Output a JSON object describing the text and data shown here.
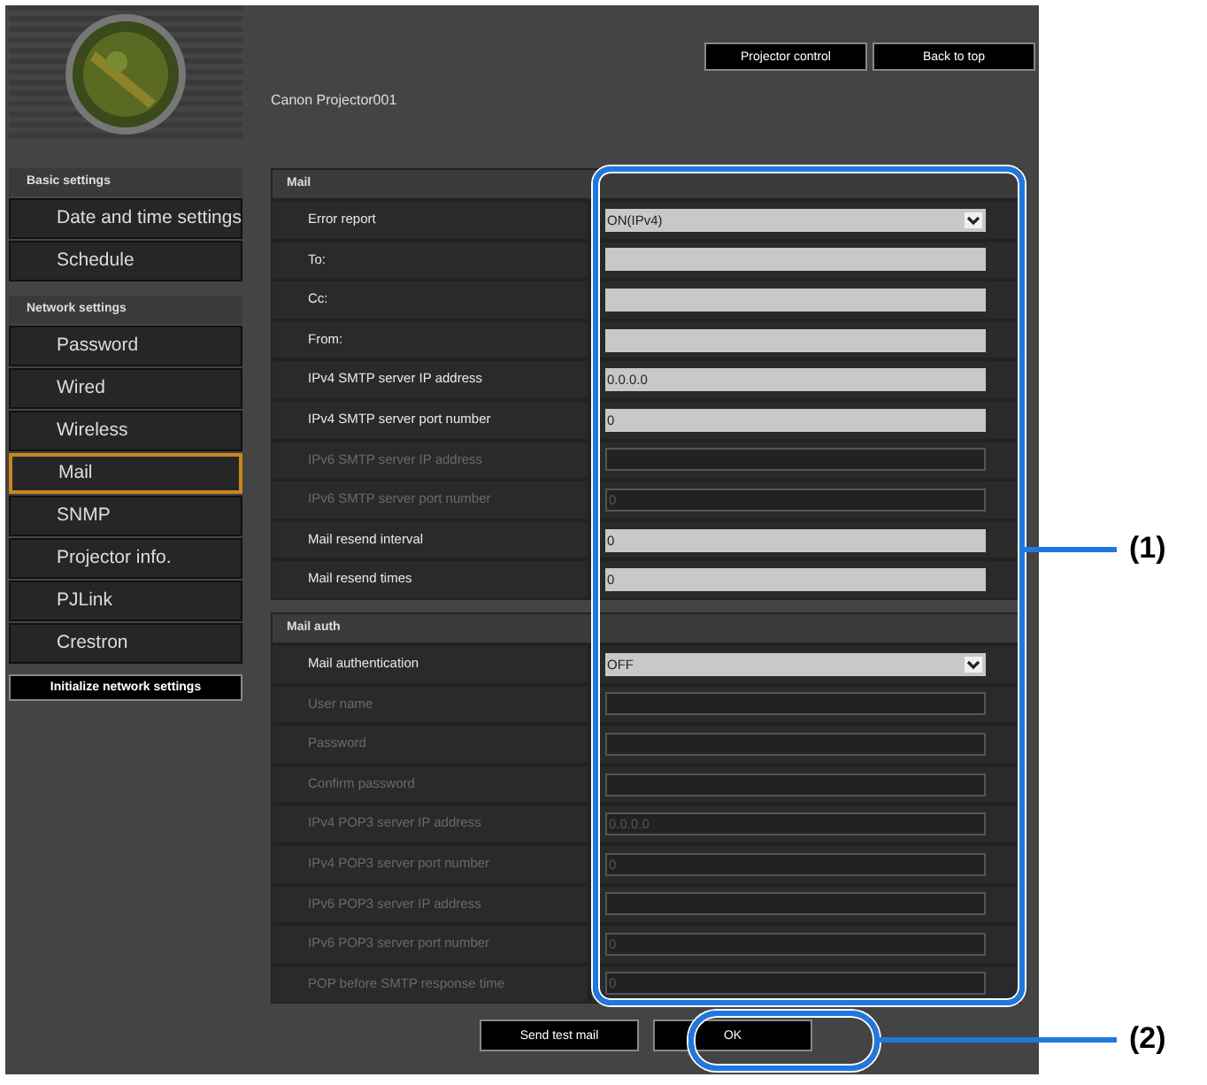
{
  "header": {
    "device_name": "Canon Projector001",
    "buttons": [
      "Projector control",
      "Back to top"
    ]
  },
  "sidebar": {
    "groups": [
      {
        "title": "Basic settings",
        "items": [
          {
            "label": "Date and time settings",
            "selected": false
          },
          {
            "label": "Schedule",
            "selected": false
          }
        ]
      },
      {
        "title": "Network settings",
        "items": [
          {
            "label": "Password",
            "selected": false
          },
          {
            "label": "Wired",
            "selected": false
          },
          {
            "label": "Wireless",
            "selected": false
          },
          {
            "label": "Mail",
            "selected": true
          },
          {
            "label": "SNMP",
            "selected": false
          },
          {
            "label": "Projector info.",
            "selected": false
          },
          {
            "label": "PJLink",
            "selected": false
          },
          {
            "label": "Crestron",
            "selected": false
          }
        ]
      }
    ],
    "action": "Initialize network settings"
  },
  "sections": [
    {
      "title": "Mail",
      "rows": [
        {
          "label": "Error report",
          "kind": "select",
          "value": "ON(IPv4)",
          "disabled": false
        },
        {
          "label": "To:",
          "kind": "text",
          "disabled": false
        },
        {
          "label": "Cc:",
          "kind": "text",
          "disabled": false
        },
        {
          "label": "From:",
          "kind": "text",
          "disabled": false
        },
        {
          "label": "IPv4 SMTP server IP address",
          "kind": "text",
          "value": "0.0.0.0",
          "disabled": false
        },
        {
          "label": "IPv4 SMTP server port number",
          "kind": "text",
          "value": "0",
          "disabled": false
        },
        {
          "label": "IPv6 SMTP server IP address",
          "kind": "text",
          "disabled": true
        },
        {
          "label": "IPv6 SMTP server port number",
          "kind": "text",
          "value": "0",
          "disabled": true
        },
        {
          "label": "Mail resend interval",
          "kind": "text",
          "value": "0",
          "disabled": false
        },
        {
          "label": "Mail resend times",
          "kind": "text",
          "value": "0",
          "disabled": false
        }
      ]
    },
    {
      "title": "Mail auth",
      "rows": [
        {
          "label": "Mail authentication",
          "kind": "select",
          "value": "OFF",
          "disabled": false
        },
        {
          "label": "User name",
          "kind": "text",
          "disabled": true
        },
        {
          "label": "Password",
          "kind": "text",
          "disabled": true
        },
        {
          "label": "Confirm password",
          "kind": "text",
          "disabled": true
        },
        {
          "label": "IPv4 POP3 server IP address",
          "kind": "text",
          "value": "0.0.0.0",
          "disabled": true
        },
        {
          "label": "IPv4 POP3 server port number",
          "kind": "text",
          "value": "0",
          "disabled": true
        },
        {
          "label": "IPv6 POP3 server IP address",
          "kind": "text",
          "disabled": true
        },
        {
          "label": "IPv6 POP3 server port number",
          "kind": "text",
          "value": "0",
          "disabled": true
        },
        {
          "label": "POP before SMTP response time",
          "kind": "text",
          "value": "0",
          "disabled": true
        }
      ]
    }
  ],
  "footer_buttons": [
    "Send test mail",
    "OK"
  ],
  "callouts": [
    "(1)",
    "(2)"
  ]
}
